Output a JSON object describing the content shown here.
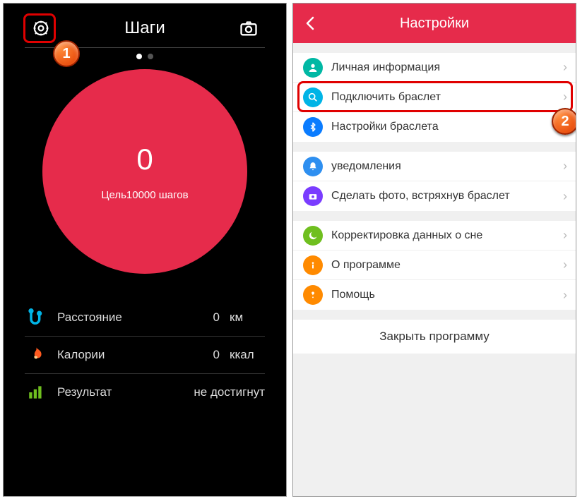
{
  "left": {
    "title": "Шаги",
    "steps": "0",
    "goal": "Цель10000 шагов",
    "stats": {
      "distance": {
        "label": "Расстояние",
        "value": "0",
        "unit": "км"
      },
      "calories": {
        "label": "Калории",
        "value": "0",
        "unit": "ккал"
      },
      "result": {
        "label": "Результат",
        "value": "не достигнут"
      }
    }
  },
  "right": {
    "title": "Настройки",
    "groups": [
      [
        {
          "label": "Личная информация"
        },
        {
          "label": "Подключить браслет"
        },
        {
          "label": "Настройки браслета"
        }
      ],
      [
        {
          "label": "уведомления"
        },
        {
          "label": "Сделать фото, встряхнув браслет"
        }
      ],
      [
        {
          "label": "Корректировка данных о сне"
        },
        {
          "label": "О программе"
        },
        {
          "label": "Помощь"
        }
      ]
    ],
    "close": "Закрыть программу"
  },
  "badges": {
    "one": "1",
    "two": "2"
  }
}
